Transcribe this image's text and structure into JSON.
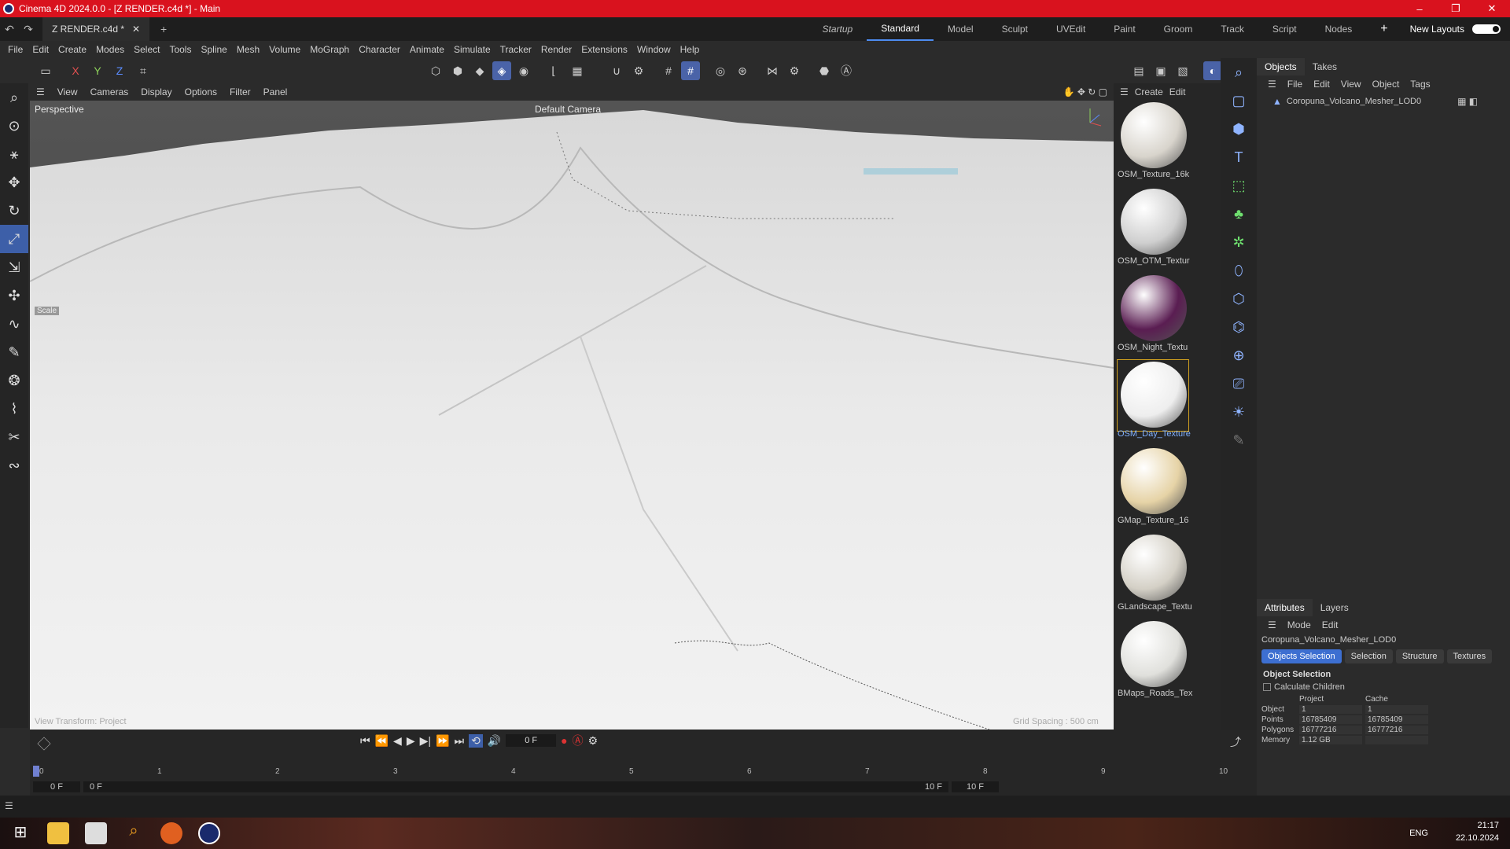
{
  "window": {
    "title": "Cinema 4D 2024.0.0 - [Z RENDER.c4d *] - Main",
    "controls": [
      "–",
      "❐",
      "✕"
    ]
  },
  "tabs": {
    "document": "Z RENDER.c4d *",
    "layouts": [
      "Startup",
      "Standard",
      "Model",
      "Sculpt",
      "UVEdit",
      "Paint",
      "Groom",
      "Track",
      "Script",
      "Nodes"
    ],
    "new_layouts": "New Layouts"
  },
  "menu": [
    "File",
    "Edit",
    "Create",
    "Modes",
    "Select",
    "Tools",
    "Spline",
    "Mesh",
    "Volume",
    "MoGraph",
    "Character",
    "Animate",
    "Simulate",
    "Tracker",
    "Render",
    "Extensions",
    "Window",
    "Help"
  ],
  "viewport": {
    "menu": [
      "View",
      "Cameras",
      "Display",
      "Options",
      "Filter",
      "Panel"
    ],
    "label": "Perspective",
    "camera": "Default Camera",
    "transform": "View Transform: Project",
    "grid_spacing": "Grid Spacing : 500 cm",
    "scale_tag": "Scale"
  },
  "materials": {
    "menu": [
      "Create",
      "Edit"
    ],
    "items": [
      {
        "name": "OSM_Texture_16k",
        "color": "#d8d4cc"
      },
      {
        "name": "OSM_OTM_Textur",
        "color": "#cfcfcf"
      },
      {
        "name": "OSM_Night_Textu",
        "color": "#5a1d52"
      },
      {
        "name": "OSM_Day_Texture",
        "color": "#eeeeee",
        "selected": true
      },
      {
        "name": "GMap_Texture_16",
        "color": "#e6d3a6"
      },
      {
        "name": "GLandscape_Textu",
        "color": "#d4d0c6"
      },
      {
        "name": "BMaps_Roads_Tex",
        "color": "#e0e0dc"
      }
    ]
  },
  "objects": {
    "tabs": [
      "Objects",
      "Takes"
    ],
    "menu": [
      "File",
      "Edit",
      "View",
      "Object",
      "Tags"
    ],
    "items": [
      "Coropuna_Volcano_Mesher_LOD0"
    ]
  },
  "attributes": {
    "tabs": [
      "Attributes",
      "Layers"
    ],
    "menu": [
      "Mode",
      "Edit"
    ],
    "object_name": "Coropuna_Volcano_Mesher_LOD0",
    "buttons": [
      "Objects Selection",
      "Selection",
      "Structure",
      "Textures"
    ],
    "section": "Object Selection",
    "calculate_children": "Calculate Children",
    "columns": [
      "Project",
      "Cache"
    ],
    "rows": [
      {
        "label": "Object",
        "project": "1",
        "cache": "1"
      },
      {
        "label": "Points",
        "project": "16785409",
        "cache": "16785409"
      },
      {
        "label": "Polygons",
        "project": "16777216",
        "cache": "16777216"
      },
      {
        "label": "Memory",
        "project": "1.12 GB",
        "cache": ""
      }
    ]
  },
  "timeline": {
    "current_frame": "0 F",
    "start": "0 F",
    "min": "0 F",
    "max": "10 F",
    "end": "10 F",
    "ticks": [
      "0",
      "1",
      "2",
      "3",
      "4",
      "5",
      "6",
      "7",
      "8",
      "9",
      "10"
    ]
  },
  "taskbar": {
    "time": "21:17",
    "date": "22.10.2024",
    "lang": "ENG"
  }
}
